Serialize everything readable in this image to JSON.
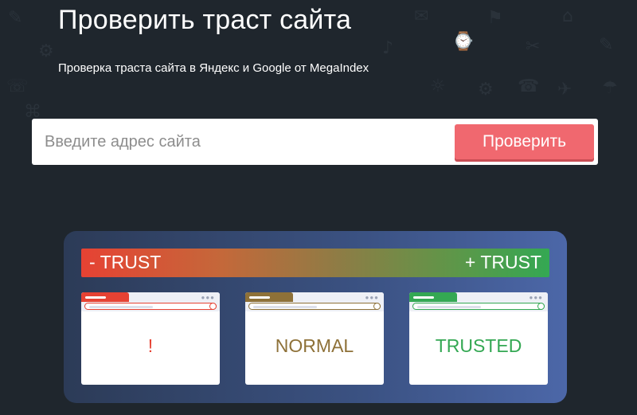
{
  "header": {
    "title": "Проверить траст сайта",
    "subtitle": "Проверка траста сайта в Яндекс и Google от MegaIndex"
  },
  "search": {
    "placeholder": "Введите адрес сайта",
    "value": "",
    "button_label": "Проверить"
  },
  "trust_scale": {
    "left_label": "- TRUST",
    "right_label": "+ TRUST"
  },
  "cards": [
    {
      "label": "!",
      "color": "#e64233"
    },
    {
      "label": "NORMAL",
      "color": "#8e7138"
    },
    {
      "label": "TRUSTED",
      "color": "#34a853"
    }
  ],
  "colors": {
    "background": "#1f262d",
    "button": "#f0686f",
    "panel": "#3b5283"
  }
}
